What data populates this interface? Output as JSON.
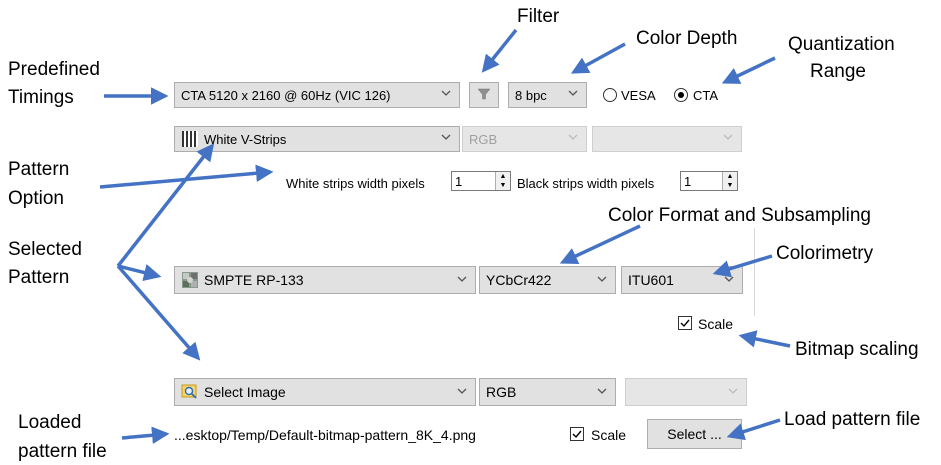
{
  "annotations": {
    "filter": "Filter",
    "color_depth": "Color Depth",
    "quantization_line1": "Quantization",
    "quantization_line2": "Range",
    "predefined_line1": "Predefined",
    "predefined_line2": "Timings",
    "pattern_option_line1": "Pattern",
    "pattern_option_line2": "Option",
    "color_format": "Color Format and Subsampling",
    "selected_pattern_line1": "Selected",
    "selected_pattern_line2": "Pattern",
    "colorimetry": "Colorimetry",
    "bitmap_scaling": "Bitmap scaling",
    "loaded_line1": "Loaded",
    "loaded_line2": "pattern file",
    "load_pattern": "Load pattern file"
  },
  "timing": {
    "selected": "CTA 5120 x 2160 @ 60Hz (VIC 126)",
    "color_depth": "8 bpc",
    "range_vesa": "VESA",
    "range_cta": "CTA",
    "range_selected": "CTA"
  },
  "pattern_row": {
    "selected": "White V-Strips",
    "color_format": "RGB",
    "colorimetry": "",
    "white_width_label": "White strips width pixels",
    "white_width_value": "1",
    "black_width_label": "Black strips width pixels",
    "black_width_value": "1"
  },
  "smpte_row": {
    "selected": "SMPTE RP-133",
    "color_format": "YCbCr422",
    "colorimetry": "ITU601",
    "scale_label": "Scale",
    "scale_checked": true
  },
  "image_row": {
    "selected": "Select Image",
    "color_format": "RGB",
    "colorimetry": "",
    "file_path": "...esktop/Temp/Default-bitmap-pattern_8K_4.png",
    "scale_label": "Scale",
    "scale_checked": true,
    "select_button": "Select ..."
  },
  "colors": {
    "arrow": "#4472c4",
    "control_bg": "#e1e1e1",
    "control_border": "#adadad"
  }
}
